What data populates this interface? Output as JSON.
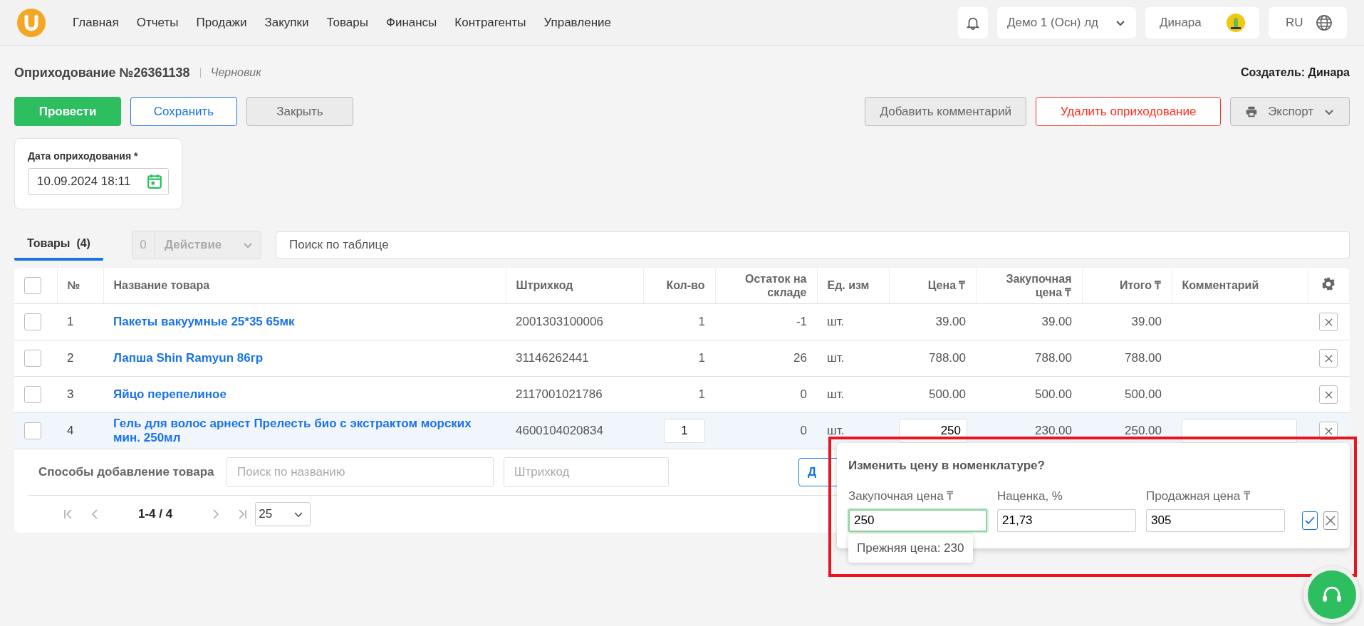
{
  "nav": {
    "items": [
      "Главная",
      "Отчеты",
      "Продажи",
      "Закупки",
      "Товары",
      "Финансы",
      "Контрагенты",
      "Управление"
    ],
    "company": "Демо 1 (Осн) лд",
    "user": "Динара",
    "language": "RU"
  },
  "document": {
    "title": "Оприходование №26361138",
    "status": "Черновик",
    "creator": "Создатель: Динара"
  },
  "actions": [
    {
      "label": "Провести",
      "kind": "primary"
    },
    {
      "label": "Сохранить",
      "kind": "outline"
    },
    {
      "label": "Закрыть",
      "kind": "grey"
    }
  ],
  "right_actions": [
    {
      "label": "Добавить комментарий",
      "kind": "grey"
    },
    {
      "label": "Удалить оприходование",
      "kind": "danger"
    },
    {
      "label": "Экспорт",
      "kind": "export"
    }
  ],
  "date_field": {
    "label": "Дата оприходования *",
    "value": "10.09.2024 18:11"
  },
  "tabs": [
    {
      "label": "Товары",
      "count": "(4)",
      "selected": true
    }
  ],
  "bulk_action": {
    "count": "0",
    "label": "Действие",
    "disabled": true
  },
  "table_search": {
    "placeholder": "Поиск по таблице"
  },
  "table": {
    "select_all": {
      "checked": false
    },
    "columns": [
      "№",
      "Название товара",
      "Штрихкод",
      "Кол-во",
      "Остаток на складе",
      "Ед. изм",
      "Цена ₸",
      "Закупочная цена ₸",
      "Итого ₸",
      "Комментарий"
    ],
    "rows": [
      {
        "checked": false,
        "editing": false,
        "number": "1",
        "name": "Пакеты вакуумные 25*35 65мк",
        "barcode": "2001303100006",
        "qty": "1",
        "stock": "-1",
        "unit": "шт.",
        "price": "39.00",
        "purchase_price": "39.00",
        "total": "39.00"
      },
      {
        "checked": false,
        "editing": false,
        "number": "2",
        "name": "Лапша Shin Ramyun 86гр",
        "barcode": "31146262441",
        "qty": "1",
        "stock": "26",
        "unit": "шт.",
        "price": "788.00",
        "purchase_price": "788.00",
        "total": "788.00"
      },
      {
        "checked": false,
        "editing": false,
        "number": "3",
        "name": "Яйцо перепелиное",
        "barcode": "2117001021786",
        "qty": "1",
        "stock": "0",
        "unit": "шт.",
        "price": "500.00",
        "purchase_price": "500.00",
        "total": "500.00"
      },
      {
        "checked": false,
        "editing": true,
        "number": "4",
        "name": "Гель для волос арнест Прелесть био с экстрактом морских мин. 250мл",
        "barcode": "4600104020834",
        "qty": "1",
        "stock": "0",
        "unit": "шт.",
        "price": "250",
        "purchase_price": "230.00",
        "total": "250.00"
      }
    ]
  },
  "add_row": {
    "label": "Способы добавление товара",
    "name_placeholder": "Поиск по названию",
    "barcode_placeholder": "Штрихкод",
    "button_visible": "Д"
  },
  "pagination": {
    "range": "1-4 / 4",
    "page_size": "25"
  },
  "price_popup": {
    "title": "Изменить цену в номенклатуре?",
    "fields": [
      {
        "label": "Закупочная цена ₸",
        "value": "250",
        "focused": true
      },
      {
        "label": "Наценка, %",
        "value": "21,73",
        "focused": false
      },
      {
        "label": "Продажная цена ₸",
        "value": "305",
        "focused": false
      }
    ],
    "hint": "Прежняя цена: 230"
  }
}
